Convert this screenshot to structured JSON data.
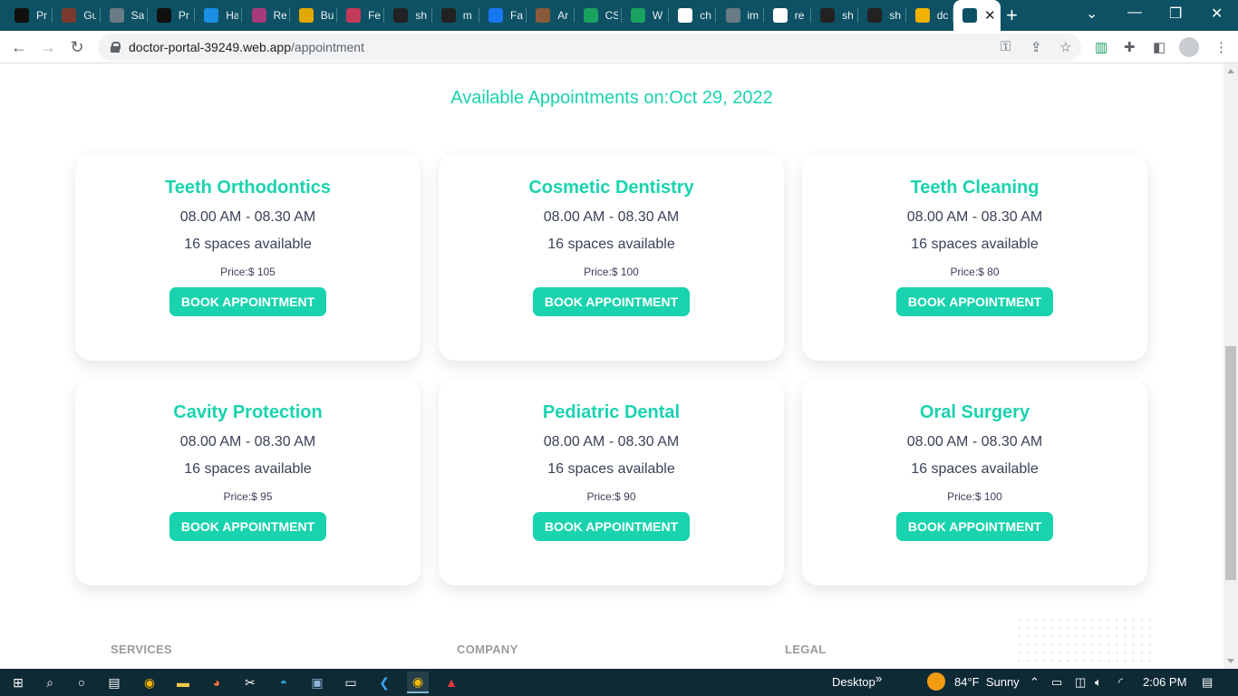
{
  "browser": {
    "tabs": [
      {
        "title": "Pr",
        "icon": "pr-icon",
        "color": "#111111"
      },
      {
        "title": "Gu",
        "icon": "guitar-icon",
        "color": "#7a3b2e"
      },
      {
        "title": "Sa",
        "icon": "globe-icon",
        "color": "#6b7b86"
      },
      {
        "title": "Pr",
        "icon": "pr-icon",
        "color": "#111111"
      },
      {
        "title": "Ha",
        "icon": "wave-icon",
        "color": "#1a8fe3"
      },
      {
        "title": "Re",
        "icon": "react-icon",
        "color": "#a63a7a"
      },
      {
        "title": "Bu",
        "icon": "flower-icon",
        "color": "#e0a800"
      },
      {
        "title": "Fe",
        "icon": "arrow-icon",
        "color": "#c43a5a"
      },
      {
        "title": "sh",
        "icon": "github-icon",
        "color": "#222222"
      },
      {
        "title": "m",
        "icon": "github-icon",
        "color": "#222222"
      },
      {
        "title": "Fa",
        "icon": "facebook-icon",
        "color": "#1877f2"
      },
      {
        "title": "Ar",
        "icon": "avatar-icon",
        "color": "#8a5a3a"
      },
      {
        "title": "CS",
        "icon": "w-icon",
        "color": "#1aa260"
      },
      {
        "title": "W",
        "icon": "w-icon",
        "color": "#1aa260"
      },
      {
        "title": "ch",
        "icon": "google-icon",
        "color": "#ffffff"
      },
      {
        "title": "im",
        "icon": "globe-icon",
        "color": "#6b7b86"
      },
      {
        "title": "re",
        "icon": "google-icon",
        "color": "#ffffff"
      },
      {
        "title": "sh",
        "icon": "github-icon",
        "color": "#222222"
      },
      {
        "title": "sh",
        "icon": "github-icon",
        "color": "#222222"
      },
      {
        "title": "dc",
        "icon": "hand-icon",
        "color": "#f2b100"
      },
      {
        "title": "",
        "icon": "react-icon",
        "color": "#0e5164",
        "active": true
      }
    ],
    "url_host": "doctor-portal-39249.web.app",
    "url_path": "/appointment"
  },
  "page": {
    "heading": "Available Appointments on:Oct 29, 2022",
    "cards": [
      {
        "name": "Teeth Orthodontics",
        "time": "08.00 AM - 08.30 AM",
        "spaces": "16 spaces available",
        "price": "Price:$ 105",
        "button": "BOOK APPOINTMENT"
      },
      {
        "name": "Cosmetic Dentistry",
        "time": "08.00 AM - 08.30 AM",
        "spaces": "16 spaces available",
        "price": "Price:$ 100",
        "button": "BOOK APPOINTMENT"
      },
      {
        "name": "Teeth Cleaning",
        "time": "08.00 AM - 08.30 AM",
        "spaces": "16 spaces available",
        "price": "Price:$ 80",
        "button": "BOOK APPOINTMENT"
      },
      {
        "name": "Cavity Protection",
        "time": "08.00 AM - 08.30 AM",
        "spaces": "16 spaces available",
        "price": "Price:$ 95",
        "button": "BOOK APPOINTMENT"
      },
      {
        "name": "Pediatric Dental",
        "time": "08.00 AM - 08.30 AM",
        "spaces": "16 spaces available",
        "price": "Price:$ 90",
        "button": "BOOK APPOINTMENT"
      },
      {
        "name": "Oral Surgery",
        "time": "08.00 AM - 08.30 AM",
        "spaces": "16 spaces available",
        "price": "Price:$ 100",
        "button": "BOOK APPOINTMENT"
      }
    ],
    "footer": {
      "col1": "SERVICES",
      "col2": "COMPANY",
      "col3": "LEGAL"
    }
  },
  "taskbar": {
    "desktop_label": "Desktop",
    "chevron": "»",
    "weather": "84°F  Sunny",
    "time": "2:06 PM"
  },
  "colors": {
    "accent": "#19d3ae",
    "tabstrip": "#0e5164",
    "taskbar": "#0e2a35"
  }
}
